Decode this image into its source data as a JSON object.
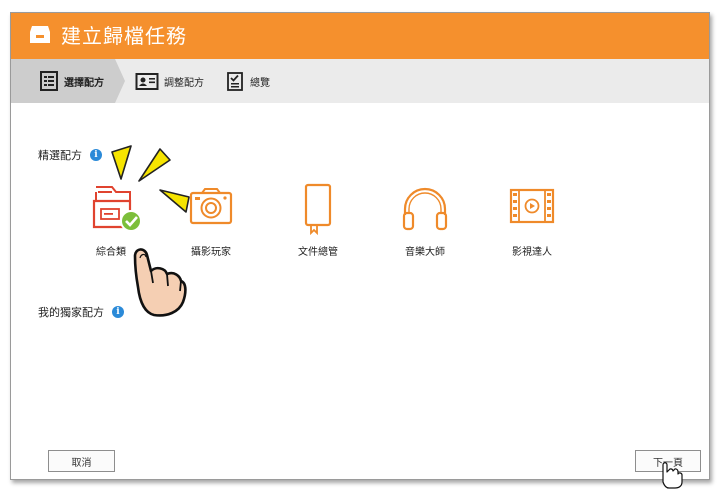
{
  "window": {
    "title": "建立歸檔任務"
  },
  "steps": [
    {
      "label": "選擇配方",
      "active": true,
      "icon": "list-document-icon"
    },
    {
      "label": "調整配方",
      "active": false,
      "icon": "id-card-icon"
    },
    {
      "label": "總覽",
      "active": false,
      "icon": "checklist-icon"
    }
  ],
  "featured": {
    "heading": "精選配方",
    "info_glyph": "i",
    "items": [
      {
        "label": "綜合類",
        "icon": "folder-check-icon",
        "selected": true
      },
      {
        "label": "攝影玩家",
        "icon": "camera-icon",
        "selected": false
      },
      {
        "label": "文件總管",
        "icon": "book-icon",
        "selected": false
      },
      {
        "label": "音樂大師",
        "icon": "headphones-icon",
        "selected": false
      },
      {
        "label": "影視達人",
        "icon": "film-icon",
        "selected": false
      }
    ]
  },
  "custom": {
    "heading": "我的獨家配方",
    "info_glyph": "i"
  },
  "buttons": {
    "cancel": "取消",
    "next": "下一頁"
  },
  "colors": {
    "accent": "#f5902d",
    "icon_orange": "#ef8a2a",
    "selected_red": "#e0432f",
    "check_green": "#7cbe3a",
    "info_blue": "#2b8ad8"
  }
}
